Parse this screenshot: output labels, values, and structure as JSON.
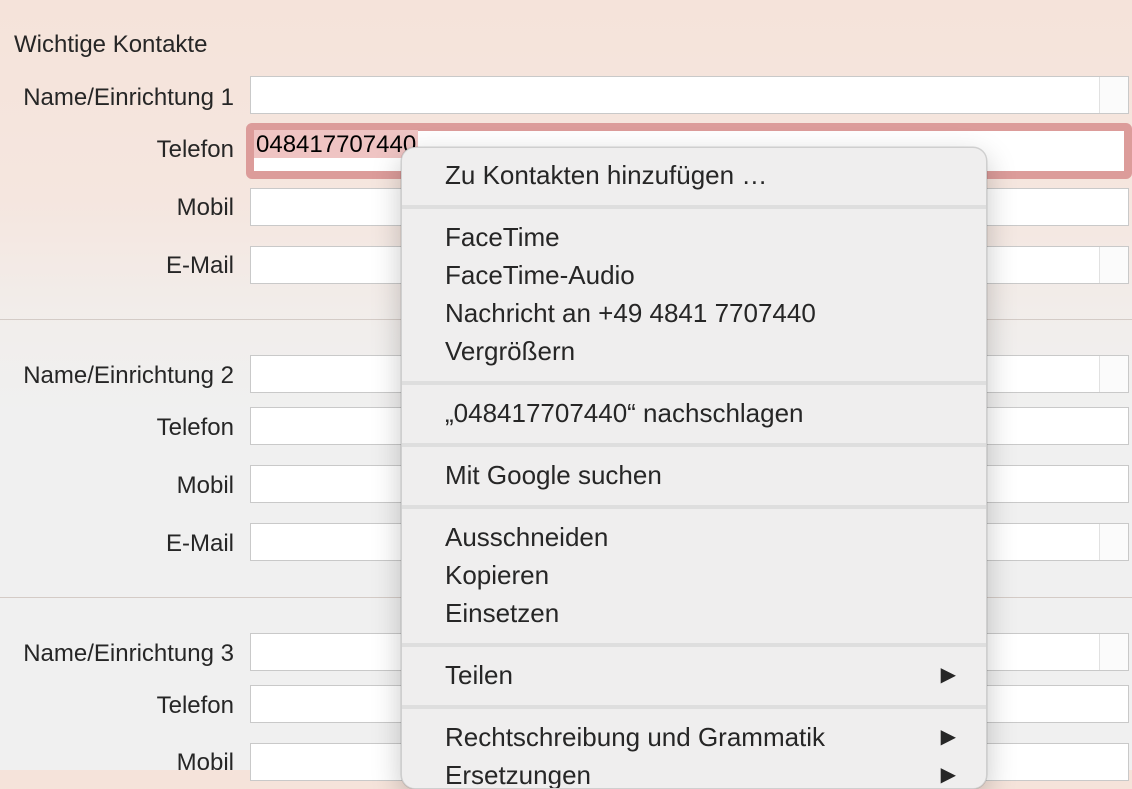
{
  "section_title": "Wichtige Kontakte",
  "contacts": [
    {
      "name_label": "Name/Einrichtung 1",
      "phone_label": "Telefon",
      "phone_value": "048417707440",
      "mobile_label": "Mobil",
      "email_label": "E-Mail"
    },
    {
      "name_label": "Name/Einrichtung 2",
      "phone_label": "Telefon",
      "mobile_label": "Mobil",
      "email_label": "E-Mail"
    },
    {
      "name_label": "Name/Einrichtung 3",
      "phone_label": "Telefon",
      "mobile_label": "Mobil"
    }
  ],
  "context_menu": {
    "add_to_contacts": "Zu Kontakten hinzufügen …",
    "facetime": "FaceTime",
    "facetime_audio": "FaceTime-Audio",
    "message": "Nachricht an +49 4841 7707440",
    "enlarge": "Vergrößern",
    "lookup": "„048417707440“ nachschlagen",
    "google_search": "Mit Google suchen",
    "cut": "Ausschneiden",
    "copy": "Kopieren",
    "paste": "Einsetzen",
    "share": "Teilen",
    "spelling": "Rechtschreibung und Grammatik",
    "substitutions": "Ersetzungen",
    "submenu_arrow": "▶"
  },
  "colors": {
    "focus_ring": "#dc9c9a",
    "selection": "#efc4c3",
    "background_top": "#f5e3da",
    "background_bottom": "#f0f0f0"
  }
}
